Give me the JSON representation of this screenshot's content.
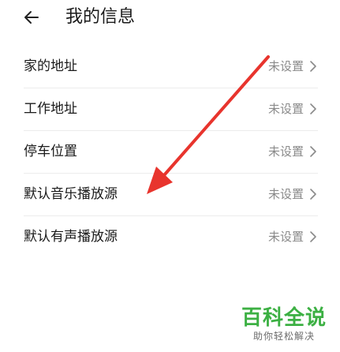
{
  "header": {
    "back_icon": "arrow-left-icon",
    "title": "我的信息"
  },
  "settings": [
    {
      "label": "家的地址",
      "value": "未设置"
    },
    {
      "label": "工作地址",
      "value": "未设置"
    },
    {
      "label": "停车位置",
      "value": "未设置"
    },
    {
      "label": "默认音乐播放源",
      "value": "未设置"
    },
    {
      "label": "默认有声播放源",
      "value": "未设置"
    }
  ],
  "annotation": {
    "icon": "red-arrow-annotation",
    "color": "#e8342d"
  },
  "watermark": {
    "main": "百科全说",
    "sub": "助你轻松解决",
    "color": "#3cb043"
  }
}
